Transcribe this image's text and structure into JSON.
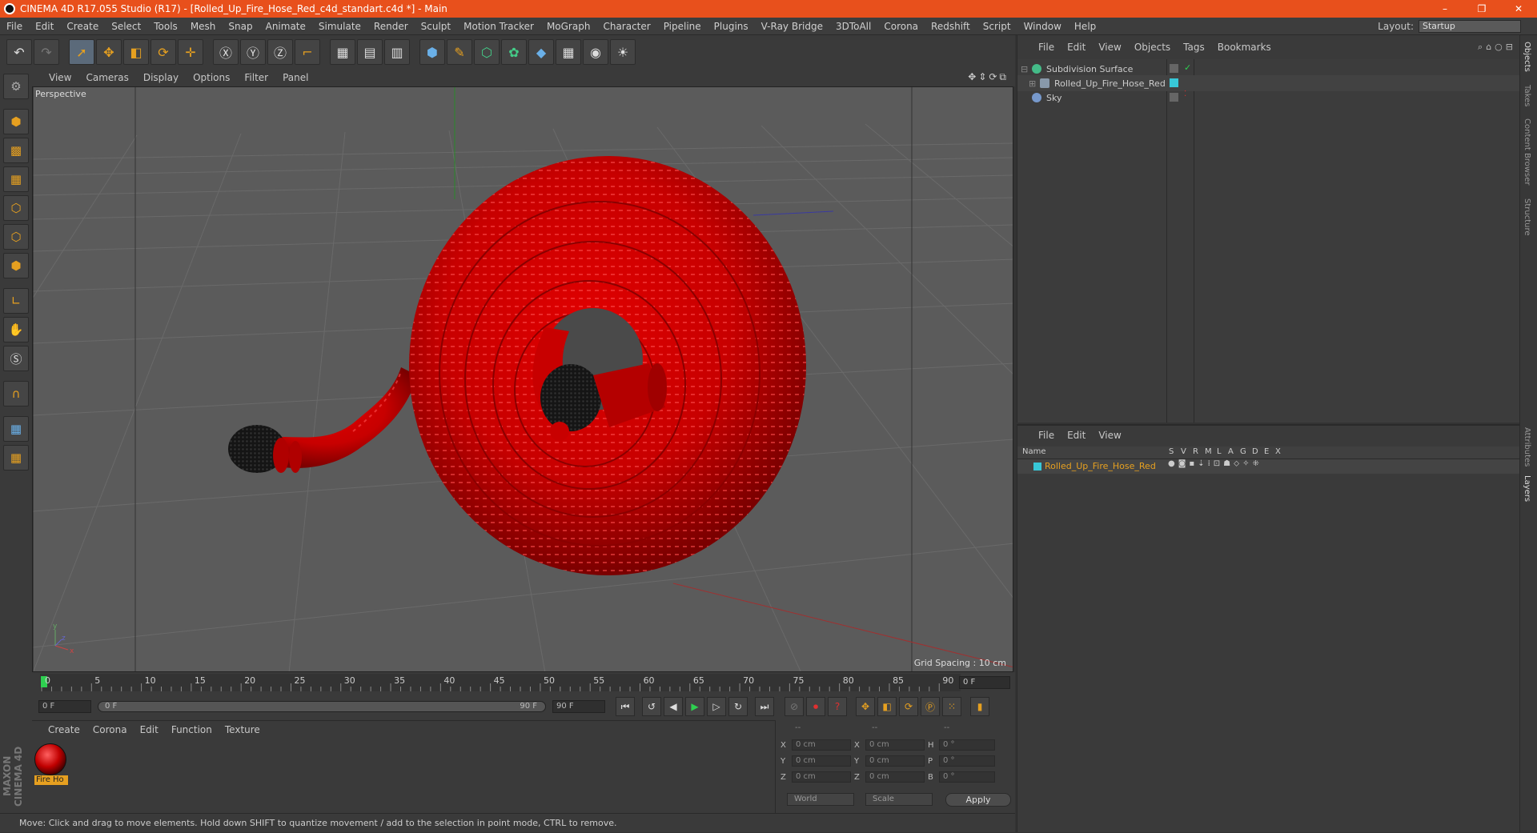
{
  "title": "CINEMA 4D R17.055 Studio (R17) - [Rolled_Up_Fire_Hose_Red_c4d_standart.c4d *] - Main",
  "window_buttons": [
    "–",
    "❐",
    "✕"
  ],
  "menu": [
    "File",
    "Edit",
    "Create",
    "Select",
    "Tools",
    "Mesh",
    "Snap",
    "Animate",
    "Simulate",
    "Render",
    "Sculpt",
    "Motion Tracker",
    "MoGraph",
    "Character",
    "Pipeline",
    "Plugins",
    "V-Ray Bridge",
    "3DToAll",
    "Corona",
    "Redshift",
    "Script",
    "Window",
    "Help"
  ],
  "layout": {
    "label": "Layout:",
    "value": "Startup"
  },
  "viewport": {
    "menu": [
      "View",
      "Cameras",
      "Display",
      "Options",
      "Filter",
      "Panel"
    ],
    "label": "Perspective",
    "grid_spacing": "Grid Spacing : 10 cm"
  },
  "timeline": {
    "ticks": [
      "0",
      "5",
      "10",
      "15",
      "20",
      "25",
      "30",
      "35",
      "40",
      "45",
      "50",
      "55",
      "60",
      "65",
      "70",
      "75",
      "80",
      "85",
      "90"
    ],
    "current_frame": "0 F",
    "start": "0 F",
    "range_start": "0 F",
    "range_end": "90 F",
    "end": "90 F"
  },
  "material_panel": {
    "menu": [
      "Create",
      "Corona",
      "Edit",
      "Function",
      "Texture"
    ],
    "material_name": "Fire Ho"
  },
  "coords": {
    "header": [
      "--",
      "--",
      "--"
    ],
    "rows": [
      {
        "a": "X",
        "av": "0 cm",
        "b": "X",
        "bv": "0 cm",
        "c": "H",
        "cv": "0 °"
      },
      {
        "a": "Y",
        "av": "0 cm",
        "b": "Y",
        "bv": "0 cm",
        "c": "P",
        "cv": "0 °"
      },
      {
        "a": "Z",
        "av": "0 cm",
        "b": "Z",
        "bv": "0 cm",
        "c": "B",
        "cv": "0 °"
      }
    ],
    "mode1": "World",
    "mode2": "Scale",
    "apply": "Apply"
  },
  "status": "Move: Click and drag to move elements. Hold down SHIFT to quantize movement / add to the selection in point mode, CTRL to remove.",
  "objects_panel": {
    "menu": [
      "File",
      "Edit",
      "View",
      "Objects",
      "Tags",
      "Bookmarks"
    ],
    "items": [
      {
        "name": "Subdivision Surface",
        "color": "#44bb88"
      },
      {
        "name": "Rolled_Up_Fire_Hose_Red",
        "color": "#8899aa"
      },
      {
        "name": "Sky",
        "color": "#7799cc"
      }
    ]
  },
  "layers_panel": {
    "menu": [
      "File",
      "Edit",
      "View"
    ],
    "columns": [
      "Name",
      "S",
      "V",
      "R",
      "M",
      "L",
      "A",
      "G",
      "D",
      "E",
      "X"
    ],
    "layer_name": "Rolled_Up_Fire_Hose_Red"
  },
  "side_tabs": [
    "Objects",
    "Takes",
    "Content Browser",
    "Structure",
    "Attributes",
    "Layers"
  ],
  "maxon": "MAXON CINEMA 4D",
  "colors": {
    "accent": "#e8501c",
    "selection": "#e6a020",
    "hose": "#d40000"
  }
}
